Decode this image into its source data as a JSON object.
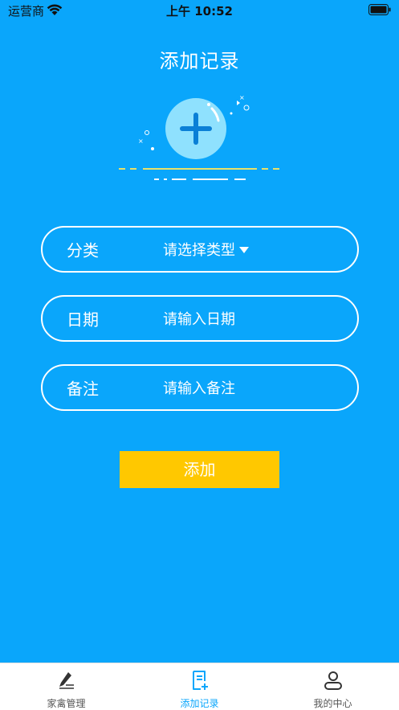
{
  "status_bar": {
    "carrier": "运营商",
    "time": "上午 10:52"
  },
  "page": {
    "title": "添加记录"
  },
  "form": {
    "category": {
      "label": "分类",
      "value": "请选择类型"
    },
    "date": {
      "label": "日期",
      "placeholder": "请输入日期"
    },
    "note": {
      "label": "备注",
      "placeholder": "请输入备注"
    },
    "submit_label": "添加"
  },
  "tabbar": {
    "items": [
      {
        "label": "家禽管理",
        "icon": "pencil-icon",
        "active": false
      },
      {
        "label": "添加记录",
        "icon": "add-document-icon",
        "active": true
      },
      {
        "label": "我的中心",
        "icon": "user-icon",
        "active": false
      }
    ]
  },
  "colors": {
    "background": "#0aa6fb",
    "button": "#ffc800",
    "active_tab": "#0aa6fb"
  }
}
